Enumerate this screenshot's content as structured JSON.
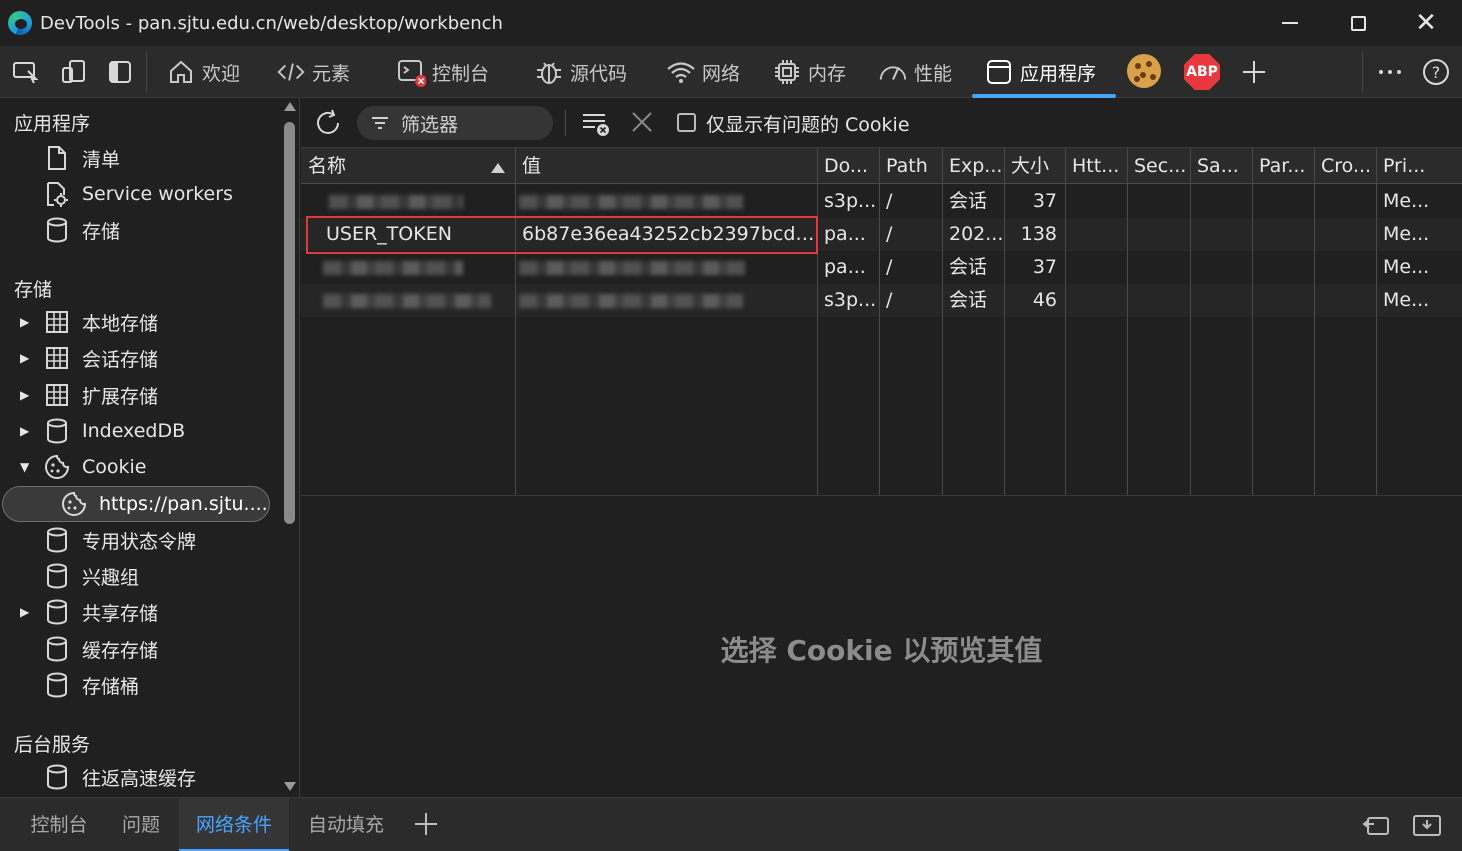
{
  "window": {
    "title": "DevTools - pan.sjtu.edu.cn/web/desktop/workbench"
  },
  "tabs": [
    {
      "label": "欢迎",
      "icon": "home-icon"
    },
    {
      "label": "元素",
      "icon": "code-icon"
    },
    {
      "label": "控制台",
      "icon": "console-icon"
    },
    {
      "label": "源代码",
      "icon": "bug-icon"
    },
    {
      "label": "网络",
      "icon": "wifi-icon"
    },
    {
      "label": "内存",
      "icon": "chip-icon"
    },
    {
      "label": "性能",
      "icon": "gauge-icon"
    },
    {
      "label": "应用程序",
      "icon": "app-window-icon",
      "active": true
    }
  ],
  "extensions": {
    "abp_label": "ABP"
  },
  "sidebar": {
    "section_app": "应用程序",
    "app_items": [
      {
        "label": "清单",
        "icon": "document-icon"
      },
      {
        "label": "Service workers",
        "icon": "gear-icon"
      },
      {
        "label": "存储",
        "icon": "cylinder-icon"
      }
    ],
    "section_storage": "存储",
    "storage_items": [
      {
        "label": "本地存储",
        "icon": "grid-icon",
        "expandable": true
      },
      {
        "label": "会话存储",
        "icon": "grid-icon",
        "expandable": true
      },
      {
        "label": "扩展存储",
        "icon": "grid-icon",
        "expandable": true
      },
      {
        "label": "IndexedDB",
        "icon": "cylinder-icon",
        "expandable": true
      },
      {
        "label": "Cookie",
        "icon": "cookie-icon",
        "expanded": true
      },
      {
        "label": "https://pan.sjtu....",
        "icon": "cookie-icon",
        "selected": true
      },
      {
        "label": "专用状态令牌",
        "icon": "cylinder-icon"
      },
      {
        "label": "兴趣组",
        "icon": "cylinder-icon"
      },
      {
        "label": "共享存储",
        "icon": "cylinder-icon",
        "expandable": true
      },
      {
        "label": "缓存存储",
        "icon": "cylinder-icon"
      },
      {
        "label": "存储桶",
        "icon": "cylinder-icon"
      }
    ],
    "section_background": "后台服务",
    "background_items": [
      {
        "label": "往返高速缓存",
        "icon": "cylinder-icon"
      }
    ]
  },
  "toolbar": {
    "filter_placeholder": "筛选器",
    "only_issues_label": "仅显示有问题的 Cookie"
  },
  "table": {
    "columns": [
      "名称",
      "值",
      "Do...",
      "Path",
      "Exp...",
      "大小",
      "Htt...",
      "Sec...",
      "Sa...",
      "Par...",
      "Cro...",
      "Pri..."
    ],
    "rows": [
      {
        "name": "",
        "value": "",
        "domain": "s3p...",
        "path": "/",
        "expires": "会话",
        "size": "37",
        "priority": "Me..."
      },
      {
        "name": "USER_TOKEN",
        "value": "6b87e36ea43252cb2397bcd20...",
        "domain": "pa...",
        "path": "/",
        "expires": "202...",
        "size": "138",
        "priority": "Me..."
      },
      {
        "name": "",
        "value": "",
        "domain": "pa...",
        "path": "/",
        "expires": "会话",
        "size": "37",
        "priority": "Me..."
      },
      {
        "name": "",
        "value": "",
        "domain": "s3p...",
        "path": "/",
        "expires": "会话",
        "size": "46",
        "priority": "Me..."
      }
    ]
  },
  "preview": {
    "message": "选择 Cookie 以预览其值"
  },
  "drawer": {
    "tabs": [
      {
        "label": "控制台"
      },
      {
        "label": "问题"
      },
      {
        "label": "网络条件",
        "active": true
      },
      {
        "label": "自动填充"
      }
    ]
  },
  "colors": {
    "accent": "#4aa3ff",
    "highlight_border": "#e0393e",
    "abp_red": "#e8383d"
  }
}
